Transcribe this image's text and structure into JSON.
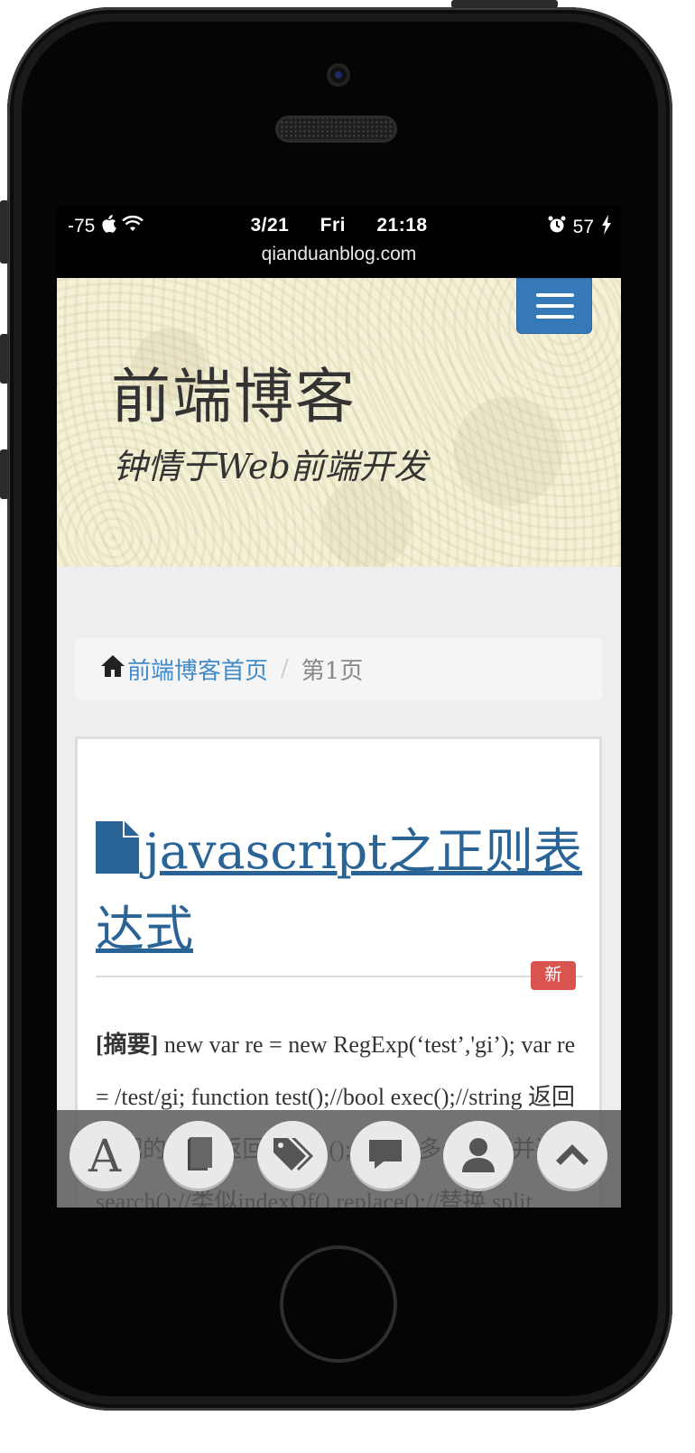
{
  "status_bar": {
    "signal": "-75",
    "date": "3/21",
    "weekday": "Fri",
    "time": "21:18",
    "battery": "57",
    "url": "qianduanblog.com"
  },
  "header": {
    "site_title": "前端博客",
    "tagline": "钟情于Web前端开发"
  },
  "breadcrumb": {
    "home_label": "前端博客首页",
    "separator": "/",
    "current": "第1页"
  },
  "post": {
    "title": "javascript之正则表达式",
    "badge": "新",
    "excerpt_label": "[摘要]",
    "excerpt_text": " new var re = new RegExp(‘test’,'gi’); var re = /test/gi; function test();//bool exec();//string 返回匹配的四个 返回 match();//array 多个匹配并返回 search();//类似indexOf() replace();//替换 split"
  },
  "bottom_bar": {
    "buttons": [
      {
        "name": "font",
        "glyph": "A"
      },
      {
        "name": "book"
      },
      {
        "name": "tags"
      },
      {
        "name": "comment"
      },
      {
        "name": "user"
      },
      {
        "name": "scroll-top"
      }
    ]
  },
  "colors": {
    "link": "#428bca",
    "title_link": "#2a6496",
    "badge": "#d9534f",
    "menu_button": "#3579b8",
    "header_bg": "#f4f1d6"
  }
}
